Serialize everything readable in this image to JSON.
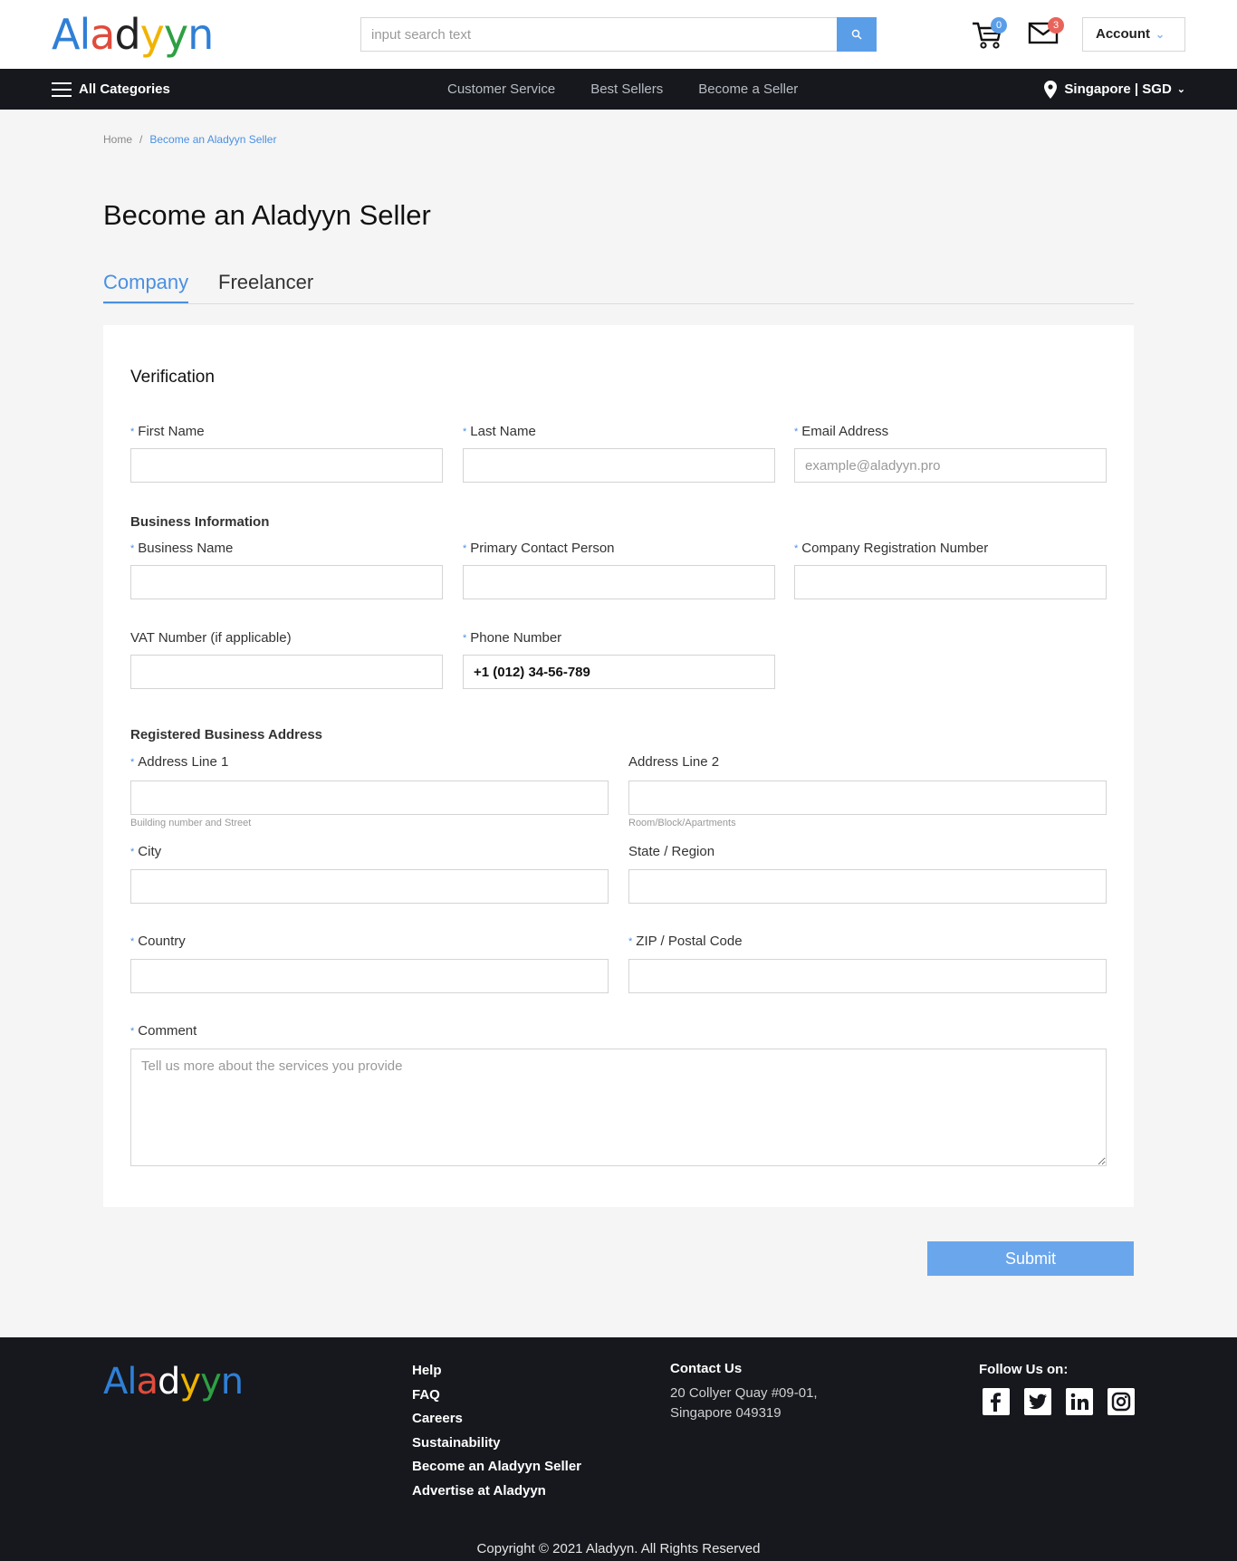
{
  "brand": {
    "name_parts": [
      "A",
      "l",
      "a",
      "d",
      "y",
      "y",
      "n"
    ]
  },
  "header": {
    "search_placeholder": "input search text",
    "cart_count": "0",
    "mail_count": "3",
    "account_label": "Account"
  },
  "nav": {
    "all_categories": "All Categories",
    "links": [
      "Customer Service",
      "Best Sellers",
      "Become a Seller"
    ],
    "region": "Singapore | SGD"
  },
  "breadcrumb": {
    "home": "Home",
    "separator": "/",
    "current": "Become an Aladyyn Seller"
  },
  "page_title": "Become an Aladyyn Seller",
  "tabs": {
    "active": "Company",
    "inactive": "Freelancer"
  },
  "form": {
    "heading": "Verification",
    "required_marker": "*",
    "first_name": {
      "label": "First Name",
      "value": ""
    },
    "last_name": {
      "label": "Last Name",
      "value": ""
    },
    "email": {
      "label": "Email Address",
      "placeholder": "example@aladyyn.pro"
    },
    "business_section": "Business Information",
    "business_name": {
      "label": "Business Name"
    },
    "primary_contact": {
      "label": "Primary Contact Person"
    },
    "company_reg": {
      "label": "Company Registration Number"
    },
    "vat": {
      "label": "VAT Number (if applicable)"
    },
    "phone": {
      "label": "Phone Number",
      "value": "+1 (012) 34-56-789"
    },
    "address_section": "Registered Business Address",
    "address1": {
      "label": "Address Line 1",
      "hint": "Building number and Street"
    },
    "address2": {
      "label": "Address Line 2",
      "hint": "Room/Block/Apartments"
    },
    "city": {
      "label": "City"
    },
    "state": {
      "label": "State / Region"
    },
    "country": {
      "label": "Country"
    },
    "zip": {
      "label": "ZIP / Postal Code"
    },
    "comment": {
      "label": "Comment",
      "placeholder": "Tell us more about the services you provide"
    },
    "submit_label": "Submit"
  },
  "footer": {
    "links": [
      "Help",
      "FAQ",
      "Careers",
      "Sustainability",
      "Become an Aladyyn Seller",
      "Advertise at Aladyyn"
    ],
    "contact_heading": "Contact Us",
    "contact_address_line1": "20 Collyer Quay #09-01,",
    "contact_address_line2": "Singapore 049319",
    "follow_label": "Follow Us on:",
    "socials": [
      "facebook-icon",
      "twitter-icon",
      "linkedin-icon",
      "instagram-icon"
    ],
    "copyright": "Copyright © 2021 Aladyyn. All Rights Reserved"
  },
  "colors": {
    "accent": "#4a90e2",
    "dark": "#16181d",
    "submit": "#6aa6ec"
  }
}
